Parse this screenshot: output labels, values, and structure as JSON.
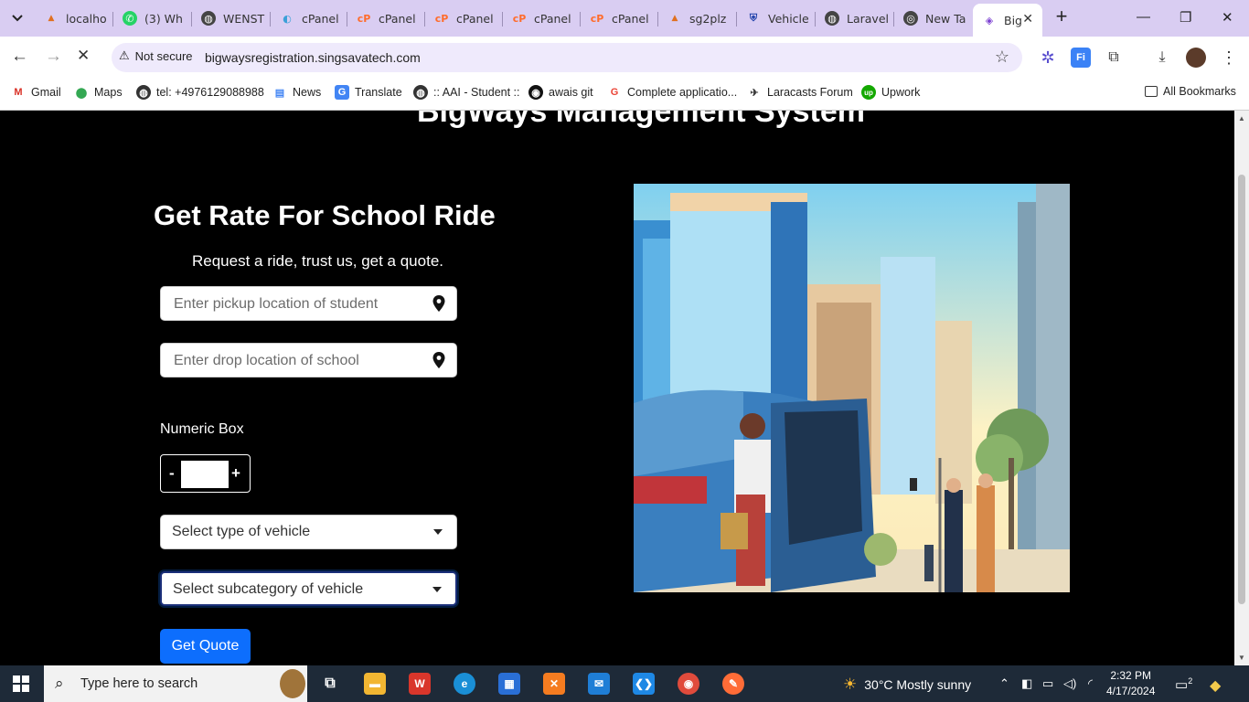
{
  "browser": {
    "tabs": [
      {
        "title": "localho",
        "icon": "phpmyadmin-icon"
      },
      {
        "title": "(3) Wh",
        "icon": "whatsapp-icon"
      },
      {
        "title": "WENST",
        "icon": "globe-icon"
      },
      {
        "title": "cPanel",
        "icon": "cpanel-login-icon"
      },
      {
        "title": "cPanel",
        "icon": "cpanel-icon"
      },
      {
        "title": "cPanel",
        "icon": "cpanel-icon"
      },
      {
        "title": "cPanel",
        "icon": "cpanel-icon"
      },
      {
        "title": "cPanel",
        "icon": "cpanel-icon"
      },
      {
        "title": "sg2plz",
        "icon": "phpmyadmin-icon"
      },
      {
        "title": "Vehicle",
        "icon": "shield-icon"
      },
      {
        "title": "Laravel",
        "icon": "globe-icon"
      },
      {
        "title": "New Ta",
        "icon": "chrome-icon"
      },
      {
        "title": "Big",
        "icon": "site-icon"
      }
    ],
    "address": {
      "security_label": "Not secure",
      "url": "bigwaysregistration.singsavatech.com"
    },
    "bookmarks": [
      {
        "label": "Gmail",
        "icon": "gmail-icon"
      },
      {
        "label": "Maps",
        "icon": "maps-icon"
      },
      {
        "label": "tel: +4976129088988",
        "icon": "globe-icon"
      },
      {
        "label": "News",
        "icon": "news-icon"
      },
      {
        "label": "Translate",
        "icon": "translate-icon"
      },
      {
        "label": ":: AAI - Student ::",
        "icon": "globe-icon"
      },
      {
        "label": "awais git",
        "icon": "github-icon"
      },
      {
        "label": "Complete applicatio...",
        "icon": "google-icon"
      },
      {
        "label": "Laracasts Forum",
        "icon": "laracasts-icon"
      },
      {
        "label": "Upwork",
        "icon": "upwork-icon"
      }
    ],
    "all_bookmarks_label": "All Bookmarks"
  },
  "page": {
    "site_title": "BigWays Management System",
    "form_title": "Get Rate For School Ride",
    "form_subtitle": "Request a ride, trust us, get a quote.",
    "pickup_placeholder": "Enter pickup location of student",
    "drop_placeholder": "Enter drop location of school",
    "numeric_label": "Numeric Box",
    "numeric_minus": "-",
    "numeric_plus": "+",
    "vehicle_type": "Select type of vehicle",
    "vehicle_subcategory": "Select subcategory of vehicle",
    "quote_button": "Get Quote"
  },
  "taskbar": {
    "search_placeholder": "Type here to search",
    "weather": "30°C  Mostly sunny",
    "time": "2:32 PM",
    "date": "4/17/2024",
    "notifications": "2"
  },
  "colors": {
    "tab_strip": "#d9cdf2",
    "omnibox": "#efeafc",
    "button_primary": "#0d6efd",
    "page_background": "#000000"
  }
}
